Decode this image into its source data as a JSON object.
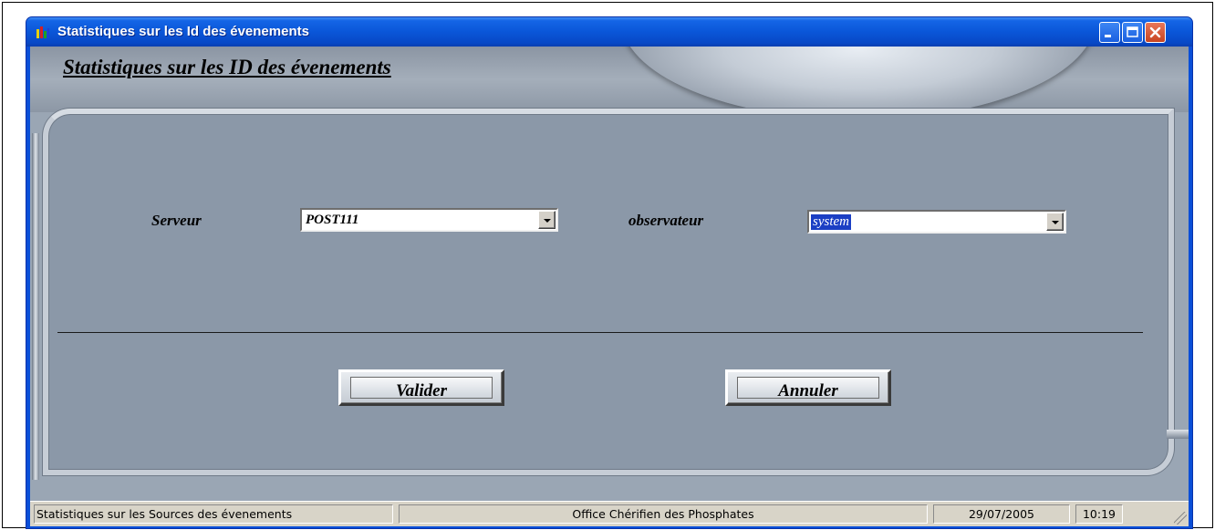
{
  "window": {
    "title": "Statistiques sur les Id des évenements"
  },
  "panel": {
    "title": "Statistiques sur les ID des évenements"
  },
  "form": {
    "server_label": "Serveur",
    "server_value": "POST111",
    "observer_label": "observateur",
    "observer_value": "system"
  },
  "actions": {
    "validate_label": "Valider",
    "cancel_label": "Annuler"
  },
  "statusbar": {
    "left": "Statistiques sur les Sources des évenements",
    "center": "Office Chérifien des Phosphates",
    "date": "29/07/2005",
    "time": "10:19"
  },
  "icons": {
    "app": "chart-app-icon",
    "minimize": "minimize-icon",
    "maximize": "maximize-icon",
    "close": "close-icon",
    "dropdown": "chevron-down-icon",
    "resize": "resize-grip-icon"
  }
}
